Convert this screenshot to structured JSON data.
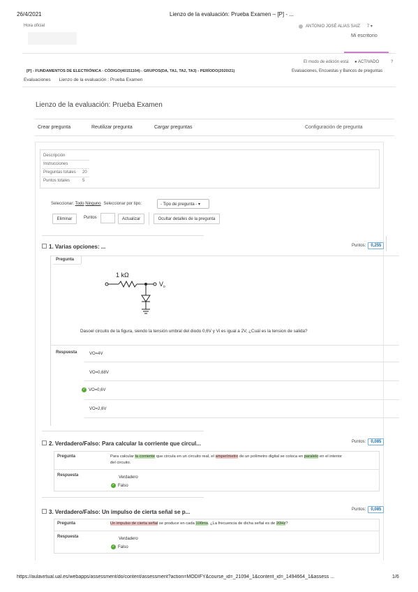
{
  "print_header": {
    "date": "26/4/2021",
    "title": "Lienzo de la evaluación: Prueba Examen – [P] - ...",
    "footer_url": "https://aulavirtual.ual.es/webapps/assessment/do/content/assessment?action=MODIFY&course_id=_21094_1&content_id=_1494664_1&assess ...",
    "page": "1/6"
  },
  "topbar": {
    "hora_oficial": "Hora oficial",
    "user": "ANTONIO JOSÉ ALIAS SAIZ",
    "user_extra": "7 ▾",
    "my_desktop": "Mi escritorio"
  },
  "edit_mode": {
    "label": "El modo de edición está:",
    "value": "● ACTIVADO",
    "help": "?"
  },
  "course": {
    "title": "[P] - FUNDAMENTOS DE ELECTRÓNICA - CÓDIGO(40151104) - GRUPOS(DA, TA1, TA2, TA3) - PERÍODO(2020/21)",
    "right_link": "Evaluaciones, Encuestas y Bancos de preguntas"
  },
  "breadcrumb": {
    "item1": "Evaluaciones",
    "item2": "Lienzo de la evaluación : Prueba Examen"
  },
  "page_title": "Lienzo de la evaluación: Prueba Examen",
  "action_bar": {
    "crear": "Crear pregunta",
    "reutilizar": "Reutilizar pregunta",
    "cargar": "Cargar preguntas",
    "config": "Configuración de pregunta"
  },
  "info_box": {
    "descripcion": "Descripción",
    "instrucciones": "Instrucciones",
    "preguntas_totales_label": "Preguntas totales",
    "preguntas_totales": "20",
    "puntos_totales_label": "Puntos totales",
    "puntos_totales": "5"
  },
  "selection": {
    "seleccionar": "Seleccionar:",
    "todo": "Todo",
    "ninguno": "Ninguno",
    "por_tipo": "Seleccionar por tipo:",
    "tipo_select": "- Tipo de pregunta - ▾"
  },
  "buttons": {
    "eliminar": "Eliminar",
    "puntos": "Puntos",
    "actualizar": "Actualizar",
    "ocultar": "Ocultar detalles de la pregunta"
  },
  "questions": [
    {
      "title": "1. Varias opciones: ...",
      "points_label": "Puntos:",
      "points": "0,255",
      "pregunta_label": "Pregunta",
      "circuit": {
        "resistor": "1 kΩ",
        "vin": "V",
        "vin_sub": "i",
        "vout": "V",
        "vout_sub": "o"
      },
      "text": "Dasoel circuito de la figura, siendo la tensión umbral del diodo 0,6V y Vi es igual a 2V, ¿Cuál es la tension de salida?",
      "respuesta_label": "Respuesta",
      "answers": [
        "VO=4V",
        "VO=0,68V",
        "VO=0,6V",
        "VO=2,6V"
      ],
      "correct_index": 2
    },
    {
      "title": "2. Verdadero/Falso: Para calcular la corriente que circul...",
      "points_label": "Puntos:",
      "points": "0,085",
      "pregunta_label": "Pregunta",
      "text_parts": [
        "Para calcular ",
        "la corriente",
        " que circula en un circuito real, el ",
        "amperímetro",
        " de un polímetro digital se coloca en ",
        "paralelo",
        " en el interior"
      ],
      "text_line2": "del circuito.",
      "respuesta_label": "Respuesta",
      "answers": [
        "Verdadero",
        "Falso"
      ],
      "correct_index": 1
    },
    {
      "title": "3. Verdadero/Falso: Un impulso de cierta señal se p...",
      "points_label": "Puntos:",
      "points": "0,085",
      "pregunta_label": "Pregunta",
      "text_parts": [
        "Un impulso de cierta señal",
        " se produce en cada ",
        "100ms",
        ". ¿La frecuencia de dicha señal es de ",
        "20Hz",
        "?"
      ],
      "respuesta_label": "Respuesta",
      "answers": [
        "Verdadero",
        "Falso"
      ],
      "correct_index": 1
    }
  ]
}
